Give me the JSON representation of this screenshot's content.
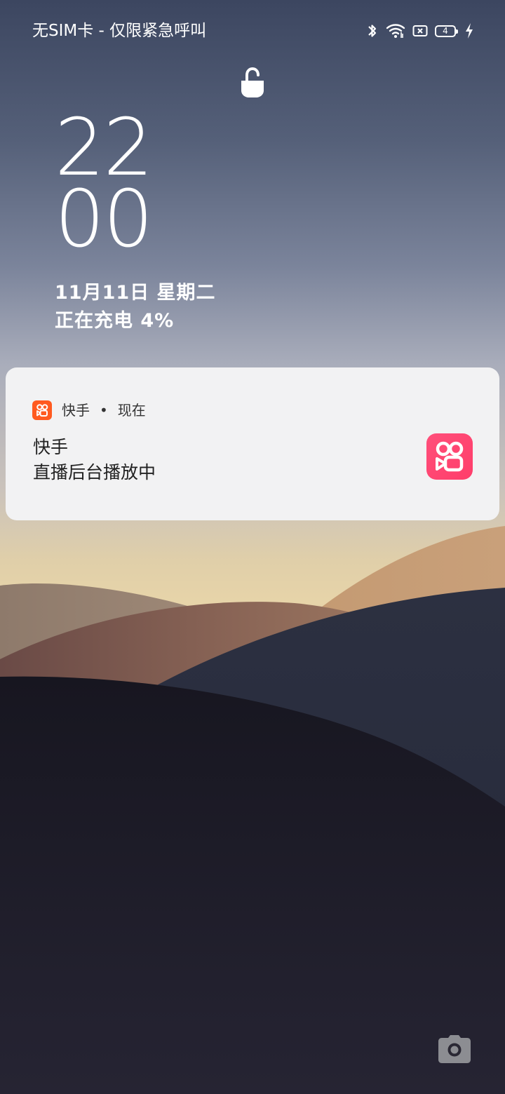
{
  "status_bar": {
    "carrier_text": "无SIM卡 - 仅限紧急呼叫",
    "battery_level": "4",
    "icons": [
      "bluetooth-icon",
      "wifi-icon",
      "sim-card-icon",
      "battery-icon",
      "charging-bolt-icon"
    ]
  },
  "lock": {
    "icon": "lock-open-icon"
  },
  "clock": {
    "hours": "22",
    "minutes": "00"
  },
  "date": {
    "text": "11月11日  星期二"
  },
  "charging": {
    "text": "正在充电 4%"
  },
  "notification": {
    "app_name": "快手",
    "separator": "•",
    "time": "现在",
    "title": "快手",
    "body": "直播后台播放中",
    "app_icon": "kuaishou-icon",
    "accent_color": "#ff3d6a",
    "small_icon_color": "#ff5a1f"
  },
  "shortcuts": {
    "camera_icon": "camera-icon"
  }
}
